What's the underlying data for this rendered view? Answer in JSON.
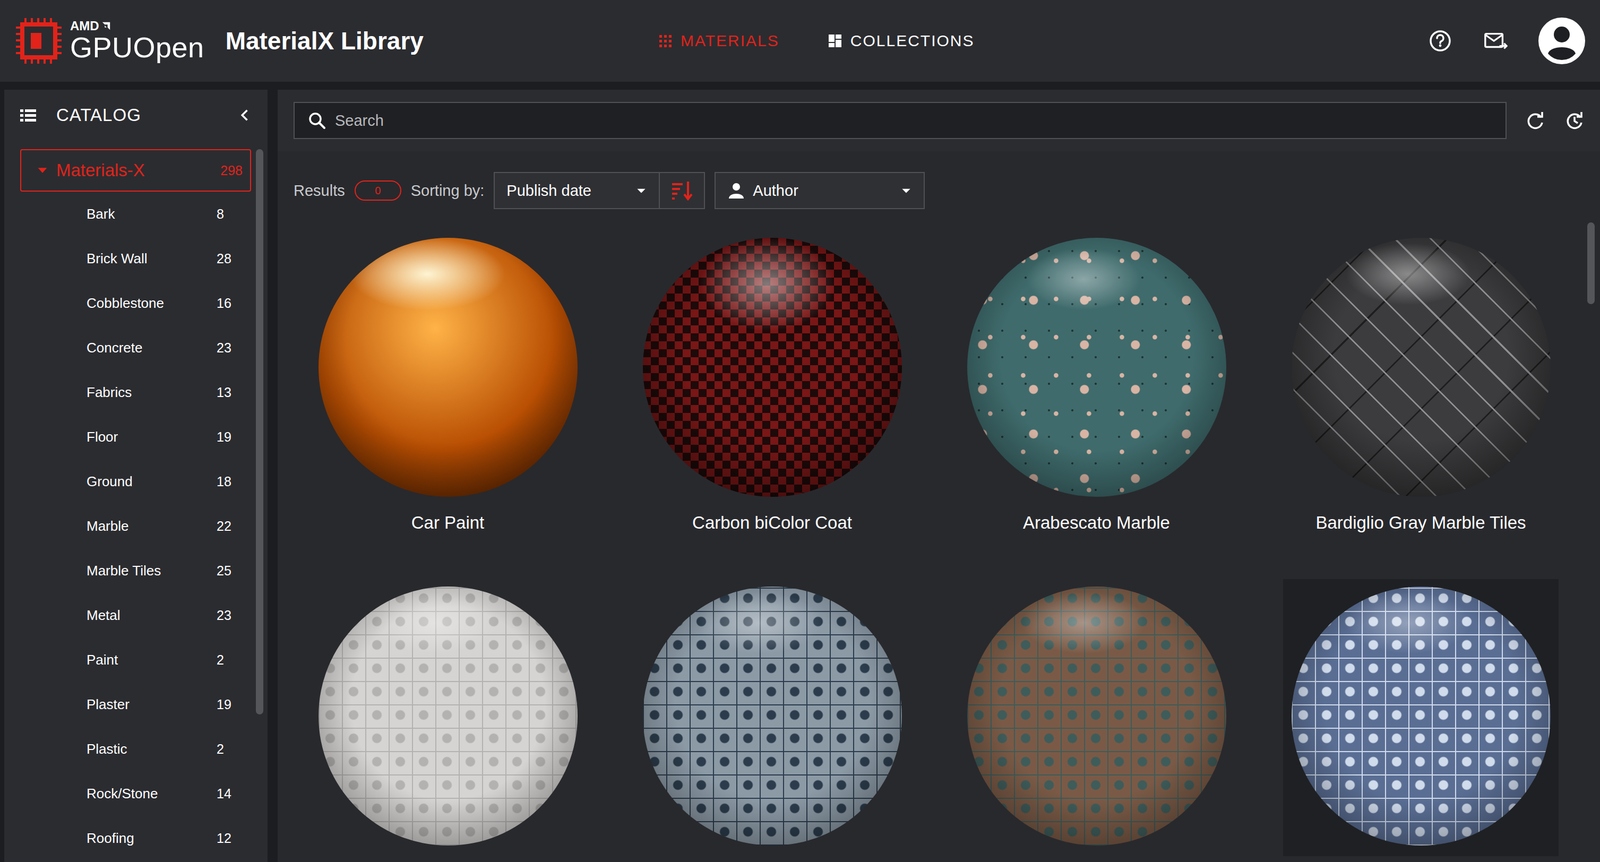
{
  "header": {
    "brand_small": "AMD",
    "brand": "GPUOpen",
    "title": "MaterialX Library",
    "nav": [
      {
        "label": "MATERIALS",
        "selected": true
      },
      {
        "label": "COLLECTIONS",
        "selected": false
      }
    ]
  },
  "sidebar": {
    "title": "CATALOG",
    "root": {
      "label": "Materials-X",
      "count": "298",
      "expanded": true,
      "selected": true
    },
    "items": [
      {
        "label": "Bark",
        "count": "8",
        "selected": false
      },
      {
        "label": "Brick Wall",
        "count": "28",
        "selected": false
      },
      {
        "label": "Cobblestone",
        "count": "16",
        "selected": false
      },
      {
        "label": "Concrete",
        "count": "23",
        "selected": false
      },
      {
        "label": "Fabrics",
        "count": "13",
        "selected": false
      },
      {
        "label": "Floor",
        "count": "19",
        "selected": false
      },
      {
        "label": "Ground",
        "count": "18",
        "selected": false
      },
      {
        "label": "Marble",
        "count": "22",
        "selected": false
      },
      {
        "label": "Marble Tiles",
        "count": "25",
        "selected": false
      },
      {
        "label": "Metal",
        "count": "23",
        "selected": false
      },
      {
        "label": "Paint",
        "count": "2",
        "selected": false
      },
      {
        "label": "Plaster",
        "count": "19",
        "selected": false
      },
      {
        "label": "Plastic",
        "count": "2",
        "selected": false
      },
      {
        "label": "Rock/Stone",
        "count": "14",
        "selected": false
      },
      {
        "label": "Roofing",
        "count": "12",
        "selected": false
      }
    ]
  },
  "search": {
    "placeholder": "Search"
  },
  "toolbar": {
    "results_label": "Results",
    "results_count": "0",
    "sorting_label": "Sorting by:",
    "sort_field": "Publish date",
    "sort_descending": true,
    "author_placeholder": "Author"
  },
  "materials": [
    {
      "name": "Car Paint",
      "kind": "gloss",
      "color": "#b84e02",
      "accent": "#ffb347",
      "highlighted": false
    },
    {
      "name": "Carbon biColor Coat",
      "kind": "checker",
      "color": "#1e0a0a",
      "accent": "#7a1616",
      "highlighted": false
    },
    {
      "name": "Arabescato Marble",
      "kind": "speckle",
      "color": "#3f6b6c",
      "accent": "#d8b4a4",
      "highlighted": false
    },
    {
      "name": "Bardiglio Gray Marble Tiles",
      "kind": "herringbone",
      "color": "#3c3c3e",
      "accent": "#8e8e90",
      "highlighted": false
    },
    {
      "kind": "tiles",
      "color": "#d6d4d2",
      "accent": "#b4b2b0",
      "highlighted": false
    },
    {
      "kind": "tiles",
      "color": "#8c9aa6",
      "accent": "#2c3c4c",
      "highlighted": false
    },
    {
      "kind": "tiles",
      "color": "#7a5a46",
      "accent": "#3e5c5a",
      "highlighted": false
    },
    {
      "kind": "tiles",
      "color": "#5a6e94",
      "accent": "#d0dbec",
      "highlighted": true
    }
  ]
}
